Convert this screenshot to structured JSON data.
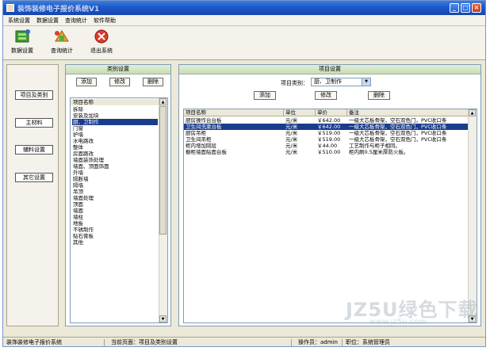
{
  "window": {
    "title": "装饰装修电子报价系统V1"
  },
  "menu": [
    "系统设置",
    "数据设置",
    "查询统计",
    "软件帮助"
  ],
  "toolbar": [
    {
      "label": "数据设置",
      "icon": "data-settings-icon"
    },
    {
      "label": "查询统计",
      "icon": "query-stats-icon"
    },
    {
      "label": "退出系统",
      "icon": "exit-icon"
    }
  ],
  "nav": [
    "项目及类别",
    "主材料",
    "辅料设置",
    "其它设置"
  ],
  "category_panel": {
    "title": "类别设置",
    "buttons": {
      "add": "添加",
      "edit": "修改",
      "delete": "删除"
    },
    "header": "项目名称",
    "items": [
      "拆除",
      "安装及加块",
      "厨、卫制作",
      "门窗",
      "护墙",
      "水电路改",
      "整体",
      "房面路改",
      "墙面装饰处理",
      "墙面、顶面饰面",
      "外墙",
      "隔断墙",
      "隔墙",
      "吊顶",
      "墙面处理",
      "顶面",
      "墙面",
      "墙柱",
      "地板",
      "不锈制作",
      "贴石膏板",
      "其他"
    ],
    "selected_index": 2
  },
  "project_panel": {
    "title": "项目设置",
    "filter_label": "项目类别：",
    "filter_value": "厨、卫制作",
    "buttons": {
      "add": "添加",
      "edit": "修改",
      "delete": "删除"
    },
    "columns": [
      "项目名称",
      "单位",
      "单价",
      "备注"
    ],
    "rows": [
      [
        "厨房操作台台板",
        "元/米",
        "￥642.00",
        "一级大芯板骨架，空石双色门，PVC收口条"
      ],
      [
        "卫生间洗漱台板",
        "元/米",
        "￥642.00",
        "一级大芯板骨架，空石双色门，PVC收口条"
      ],
      [
        "厨房吊柜",
        "元/米",
        "￥519.00",
        "一级大芯板骨架，空石双色门，PVC收口条"
      ],
      [
        "卫生间吊柜",
        "元/米",
        "￥519.00",
        "一级大芯板骨架，空石双色门，PVC收口条"
      ],
      [
        "柜内增加隔层",
        "元/米",
        "￥44.00",
        "工艺制作与柜子相同。"
      ],
      [
        "橱柜墙面贴面台板",
        "元/米",
        "￥510.00",
        "柜内刷0.5厘米厚防火板。"
      ]
    ],
    "selected_index": 1
  },
  "status": {
    "app": "装饰装修电子报价系统",
    "page": "当前页面：项目及类别设置",
    "operator": "操作员：admin",
    "role": "职位：系统管理员"
  },
  "watermark": {
    "big": "JZ5U绿色下载",
    "small": "www.jz5u.com"
  }
}
